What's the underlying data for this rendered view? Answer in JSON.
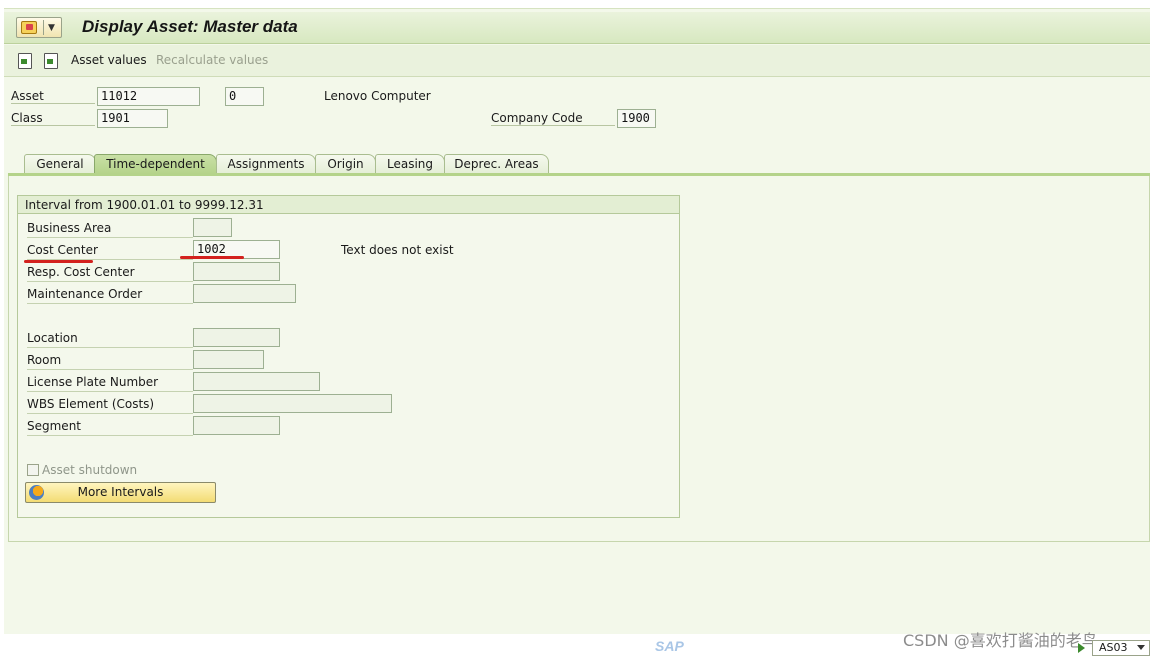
{
  "window": {
    "title": "Display Asset:  Master data"
  },
  "toolbar": {
    "asset_values_label": "Asset values",
    "recalculate_values_label": "Recalculate values"
  },
  "header": {
    "asset_label": "Asset",
    "asset_number": "11012",
    "sub_number": "0",
    "asset_description": "Lenovo Computer",
    "class_label": "Class",
    "class_value": "1901",
    "company_code_label": "Company Code",
    "company_code_value": "1900"
  },
  "tabs": [
    {
      "label": "General"
    },
    {
      "label": "Time-dependent",
      "active": true
    },
    {
      "label": "Assignments"
    },
    {
      "label": "Origin"
    },
    {
      "label": "Leasing"
    },
    {
      "label": "Deprec. Areas"
    }
  ],
  "time_dependent": {
    "interval_header": "Interval from 1900.01.01 to 9999.12.31",
    "business_area_label": "Business Area",
    "business_area_value": "",
    "cost_center_label": "Cost Center",
    "cost_center_value": "1002",
    "cost_center_text": "Text does not exist",
    "resp_cost_center_label": "Resp. Cost Center",
    "resp_cost_center_value": "",
    "maintenance_order_label": "Maintenance Order",
    "maintenance_order_value": "",
    "location_label": "Location",
    "location_value": "",
    "room_label": "Room",
    "room_value": "",
    "license_plate_label": "License Plate Number",
    "license_plate_value": "",
    "wbs_element_label": "WBS Element (Costs)",
    "wbs_element_value": "",
    "segment_label": "Segment",
    "segment_value": "",
    "asset_shutdown_label": "Asset shutdown",
    "asset_shutdown_checked": false,
    "more_intervals_label": "More Intervals"
  },
  "status_bar": {
    "sap_logo": "SAP",
    "transaction": "AS03",
    "watermark": "CSDN @喜欢打酱油的老鸟"
  },
  "colors": {
    "active_tab": "#b4d38a",
    "panel_background": "#f3f8ea",
    "annotation_underline": "#d3211e",
    "button_yellow": "#f3dc74"
  },
  "icons": {
    "menu": "sap-menu-icon",
    "asset_values": "document-back-icon",
    "recalculate": "document-forward-icon",
    "more_intervals": "intervals-icon"
  }
}
